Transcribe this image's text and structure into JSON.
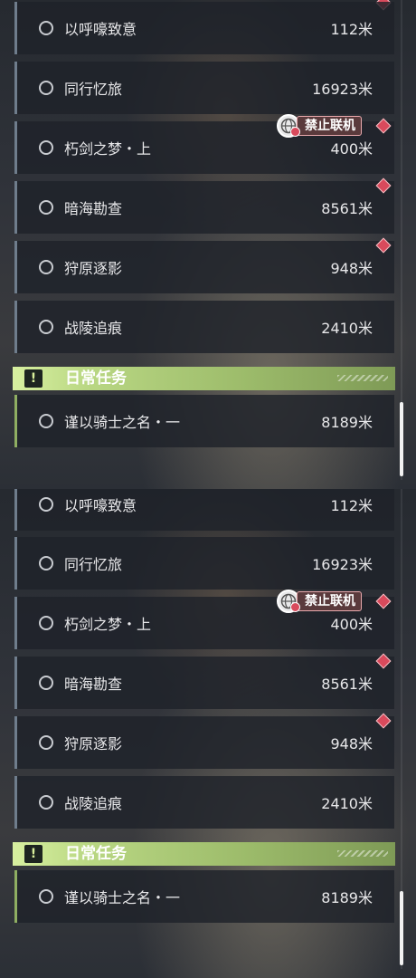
{
  "panels": [
    {
      "quests": [
        {
          "name": "以呼嚎致意",
          "distance": "112米"
        },
        {
          "name": "同行忆旅",
          "distance": "16923米"
        },
        {
          "name": "朽剑之梦・上",
          "distance": "400米"
        },
        {
          "name": "暗海勘查",
          "distance": "8561米"
        },
        {
          "name": "狩原逐影",
          "distance": "948米"
        },
        {
          "name": "战陵追痕",
          "distance": "2410米"
        }
      ],
      "online_badge": "禁止联机",
      "daily_header": "日常任务",
      "daily_quest": {
        "name": "谨以骑士之名・一",
        "distance": "8189米"
      }
    },
    {
      "quests": [
        {
          "name": "以呼嚎致意",
          "distance": "112米"
        },
        {
          "name": "同行忆旅",
          "distance": "16923米"
        },
        {
          "name": "朽剑之梦・上",
          "distance": "400米"
        },
        {
          "name": "暗海勘查",
          "distance": "8561米"
        },
        {
          "name": "狩原逐影",
          "distance": "948米"
        },
        {
          "name": "战陵追痕",
          "distance": "2410米"
        }
      ],
      "online_badge": "禁止联机",
      "daily_header": "日常任务",
      "daily_quest": {
        "name": "谨以骑士之名・一",
        "distance": "8189米"
      }
    }
  ],
  "icons": {
    "quest_status": "empty-circle-icon",
    "new_marker": "red-diamond-icon",
    "online": "globe-no-multiplayer-icon",
    "daily": "exclamation-icon"
  },
  "colors": {
    "new_marker": "#d94a5c",
    "daily_accent": "#b9d783",
    "quest_border": "#6f7d8c"
  }
}
